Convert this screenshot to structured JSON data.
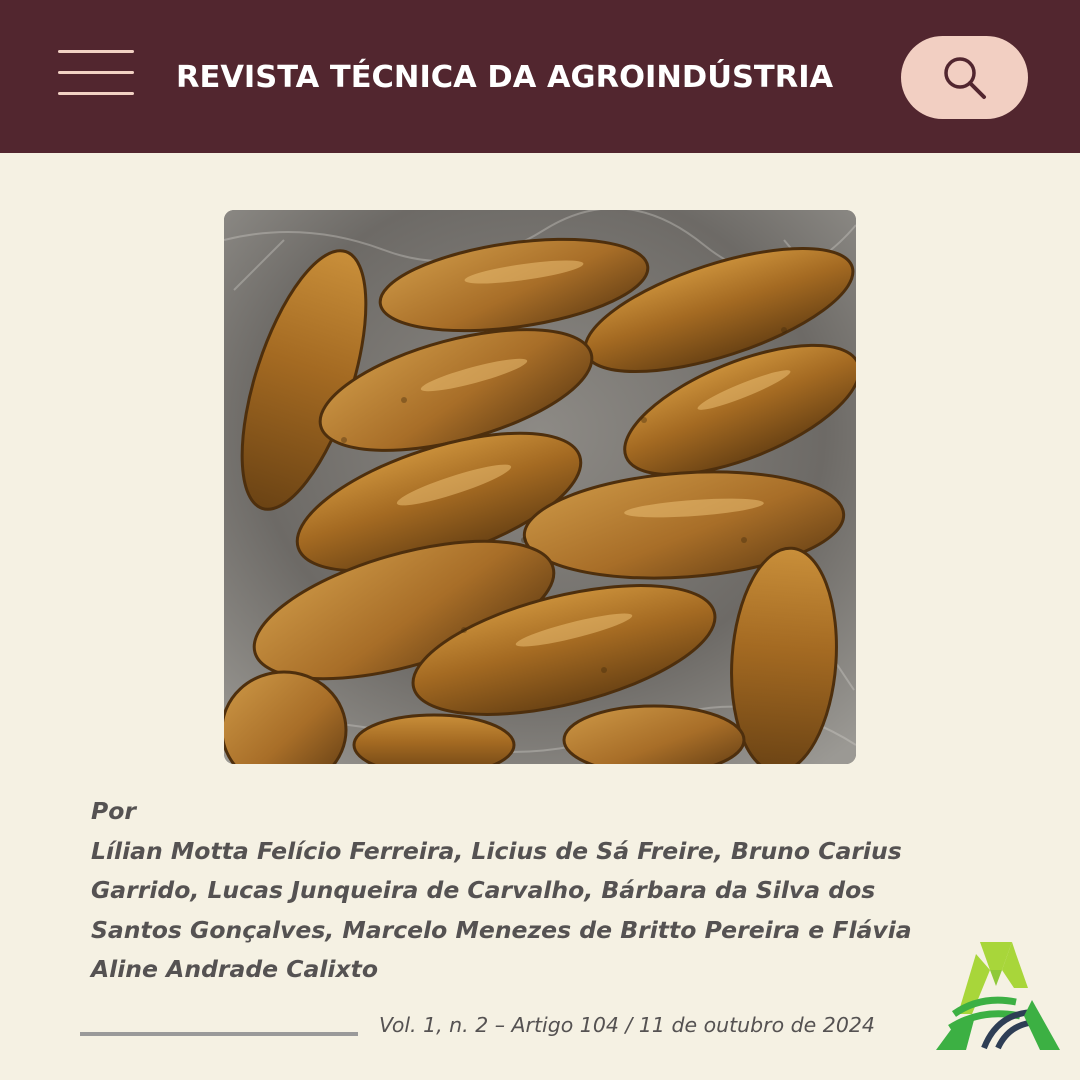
{
  "header": {
    "title": "REVISTA TÉCNICA DA AGROINDÚSTRIA",
    "menu_icon": "hamburger-menu-icon",
    "search_icon": "search-icon"
  },
  "article": {
    "photo_alt": "",
    "byline_label": "Por",
    "authors": "Lílian Motta Felício Ferreira, Licius de Sá Freire, Bruno Carius Garrido, Lucas Junqueira de Carvalho, Bárbara da Silva dos Santos Gonçalves, Marcelo Menezes de Britto Pereira e Flávia Aline Andrade Calixto",
    "issue_info": "Vol. 1, n. 2 – Artigo 104 / 11 de outubro de 2024"
  },
  "colors": {
    "header_bg": "#52262f",
    "page_bg": "#f5f1e3",
    "accent_pink": "#f2cfc2",
    "text_gray": "#555252",
    "logo_green_light": "#a8d63a",
    "logo_green": "#3cb043",
    "logo_navy": "#2e3e55"
  },
  "logo": {
    "icon": "journal-logo-icon"
  }
}
